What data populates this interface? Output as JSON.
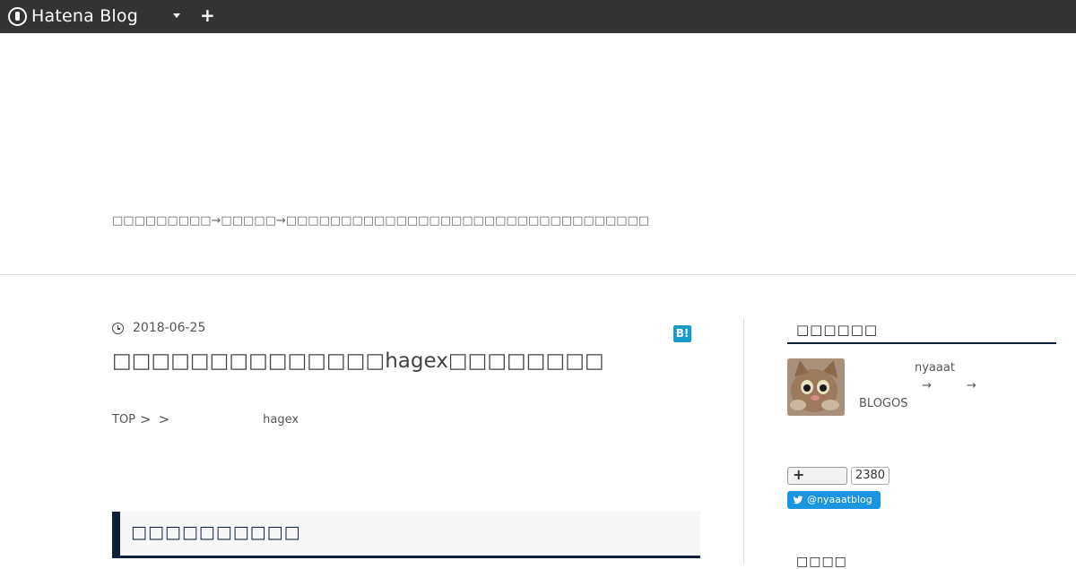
{
  "topbar": {
    "logo_text": "Hatena Blog",
    "dropdown_icon": "caret-down-icon",
    "plus_icon": "plus-icon",
    "plus_symbol": "+"
  },
  "header": {
    "description": "□□□□□□□□□→□□□□□→□□□□□□□□□□□□□□□□□□□□□□□□□□□□□□□□□"
  },
  "article": {
    "date": "2018-06-25",
    "bookmark_label": "B!",
    "title": "□□□□□□□□□□□□□□hagex□□□□□□□□",
    "breadcrumb": {
      "top": "TOP",
      "sep1": ">",
      "sep2": ">",
      "last": "hagex"
    },
    "section_heading": "□□□□□□□□□□"
  },
  "sidebar": {
    "profile_heading": "□□□□□□",
    "profile_name": "nyaaat",
    "profile_arrow1": "→",
    "profile_arrow2": "→",
    "profile_blogos": "BLOGOS",
    "follow_plus": "+",
    "follow_count": "2380",
    "twitter_handle": "@nyaaatblog",
    "next_heading": "□□□□"
  },
  "colors": {
    "topbar_bg": "#333333",
    "accent_navy": "#0f1f3a",
    "hatena_blue": "#139ccc",
    "twitter_blue": "#1b95e0"
  }
}
